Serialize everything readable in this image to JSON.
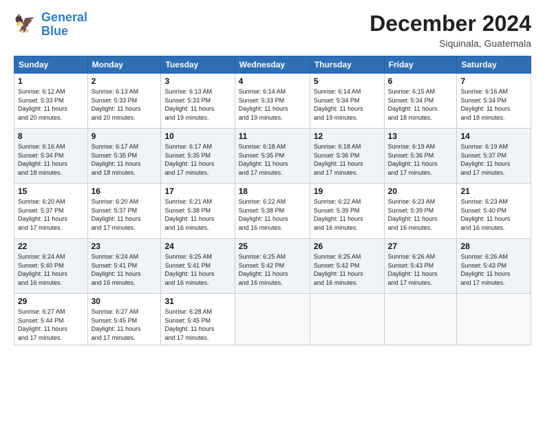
{
  "header": {
    "logo_line1": "General",
    "logo_line2": "Blue",
    "title": "December 2024",
    "location": "Siquinala, Guatemala"
  },
  "days_of_week": [
    "Sunday",
    "Monday",
    "Tuesday",
    "Wednesday",
    "Thursday",
    "Friday",
    "Saturday"
  ],
  "weeks": [
    [
      {
        "day": "1",
        "info": "Sunrise: 6:12 AM\nSunset: 5:33 PM\nDaylight: 11 hours\nand 20 minutes."
      },
      {
        "day": "2",
        "info": "Sunrise: 6:13 AM\nSunset: 5:33 PM\nDaylight: 11 hours\nand 20 minutes."
      },
      {
        "day": "3",
        "info": "Sunrise: 6:13 AM\nSunset: 5:33 PM\nDaylight: 11 hours\nand 19 minutes."
      },
      {
        "day": "4",
        "info": "Sunrise: 6:14 AM\nSunset: 5:33 PM\nDaylight: 11 hours\nand 19 minutes."
      },
      {
        "day": "5",
        "info": "Sunrise: 6:14 AM\nSunset: 5:34 PM\nDaylight: 11 hours\nand 19 minutes."
      },
      {
        "day": "6",
        "info": "Sunrise: 6:15 AM\nSunset: 5:34 PM\nDaylight: 11 hours\nand 18 minutes."
      },
      {
        "day": "7",
        "info": "Sunrise: 6:16 AM\nSunset: 5:34 PM\nDaylight: 11 hours\nand 18 minutes."
      }
    ],
    [
      {
        "day": "8",
        "info": "Sunrise: 6:16 AM\nSunset: 5:34 PM\nDaylight: 11 hours\nand 18 minutes."
      },
      {
        "day": "9",
        "info": "Sunrise: 6:17 AM\nSunset: 5:35 PM\nDaylight: 11 hours\nand 18 minutes."
      },
      {
        "day": "10",
        "info": "Sunrise: 6:17 AM\nSunset: 5:35 PM\nDaylight: 11 hours\nand 17 minutes."
      },
      {
        "day": "11",
        "info": "Sunrise: 6:18 AM\nSunset: 5:35 PM\nDaylight: 11 hours\nand 17 minutes."
      },
      {
        "day": "12",
        "info": "Sunrise: 6:18 AM\nSunset: 5:36 PM\nDaylight: 11 hours\nand 17 minutes."
      },
      {
        "day": "13",
        "info": "Sunrise: 6:19 AM\nSunset: 5:36 PM\nDaylight: 11 hours\nand 17 minutes."
      },
      {
        "day": "14",
        "info": "Sunrise: 6:19 AM\nSunset: 5:37 PM\nDaylight: 11 hours\nand 17 minutes."
      }
    ],
    [
      {
        "day": "15",
        "info": "Sunrise: 6:20 AM\nSunset: 5:37 PM\nDaylight: 11 hours\nand 17 minutes."
      },
      {
        "day": "16",
        "info": "Sunrise: 6:20 AM\nSunset: 5:37 PM\nDaylight: 11 hours\nand 17 minutes."
      },
      {
        "day": "17",
        "info": "Sunrise: 6:21 AM\nSunset: 5:38 PM\nDaylight: 11 hours\nand 16 minutes."
      },
      {
        "day": "18",
        "info": "Sunrise: 6:22 AM\nSunset: 5:38 PM\nDaylight: 11 hours\nand 16 minutes."
      },
      {
        "day": "19",
        "info": "Sunrise: 6:22 AM\nSunset: 5:39 PM\nDaylight: 11 hours\nand 16 minutes."
      },
      {
        "day": "20",
        "info": "Sunrise: 6:23 AM\nSunset: 5:39 PM\nDaylight: 11 hours\nand 16 minutes."
      },
      {
        "day": "21",
        "info": "Sunrise: 6:23 AM\nSunset: 5:40 PM\nDaylight: 11 hours\nand 16 minutes."
      }
    ],
    [
      {
        "day": "22",
        "info": "Sunrise: 6:24 AM\nSunset: 5:40 PM\nDaylight: 11 hours\nand 16 minutes."
      },
      {
        "day": "23",
        "info": "Sunrise: 6:24 AM\nSunset: 5:41 PM\nDaylight: 11 hours\nand 16 minutes."
      },
      {
        "day": "24",
        "info": "Sunrise: 6:25 AM\nSunset: 5:41 PM\nDaylight: 11 hours\nand 16 minutes."
      },
      {
        "day": "25",
        "info": "Sunrise: 6:25 AM\nSunset: 5:42 PM\nDaylight: 11 hours\nand 16 minutes."
      },
      {
        "day": "26",
        "info": "Sunrise: 6:25 AM\nSunset: 5:42 PM\nDaylight: 11 hours\nand 16 minutes."
      },
      {
        "day": "27",
        "info": "Sunrise: 6:26 AM\nSunset: 5:43 PM\nDaylight: 11 hours\nand 17 minutes."
      },
      {
        "day": "28",
        "info": "Sunrise: 6:26 AM\nSunset: 5:43 PM\nDaylight: 11 hours\nand 17 minutes."
      }
    ],
    [
      {
        "day": "29",
        "info": "Sunrise: 6:27 AM\nSunset: 5:44 PM\nDaylight: 11 hours\nand 17 minutes."
      },
      {
        "day": "30",
        "info": "Sunrise: 6:27 AM\nSunset: 5:45 PM\nDaylight: 11 hours\nand 17 minutes."
      },
      {
        "day": "31",
        "info": "Sunrise: 6:28 AM\nSunset: 5:45 PM\nDaylight: 11 hours\nand 17 minutes."
      },
      null,
      null,
      null,
      null
    ]
  ]
}
